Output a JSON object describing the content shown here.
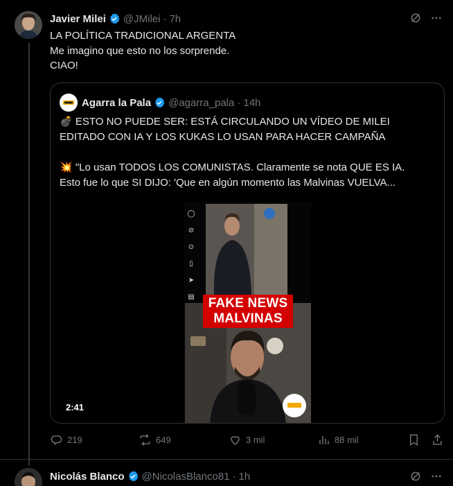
{
  "tweet": {
    "author_name": "Javier Milei",
    "author_handle": "@JMilei",
    "time": "7h",
    "lines": [
      "LA POLÍTICA TRADICIONAL ARGENTA",
      "Me imagino que esto no los sorprende.",
      "CIAO!"
    ],
    "icons": [
      "grok-icon",
      "more-icon"
    ]
  },
  "quote": {
    "author_name": "Agarra la Pala",
    "author_handle": "@agarra_pala",
    "time": "14h",
    "line1": "💣 ESTO NO PUEDE SER: ESTÁ CIRCULANDO UN VÍDEO DE MILEI",
    "line2": "EDITADO CON IA Y LOS KUKAS LO USAN PARA HACER CAMPAÑA",
    "line3": "💥 \"Lo usan TODOS LOS COMUNISTAS. Claramente se nota QUE ES IA.",
    "line4": "Esto fue lo que SI DIJO: 'Que en algún momento las Malvinas VUELVA...",
    "video_overlay_line1": "FAKE NEWS",
    "video_overlay_line2": "MALVINAS",
    "video_duration": "2:41",
    "overlay_color": "#d40000"
  },
  "actions": {
    "reply_count": "219",
    "repost_count": "649",
    "like_count": "3 mil",
    "views_count": "88 mil"
  },
  "next_tweet": {
    "author_name": "Nicolás Blanco",
    "author_handle": "@NicolasBlanco81",
    "time": "1h"
  },
  "colors": {
    "background": "#000000",
    "text": "#e7e9ea",
    "muted": "#71767b",
    "border": "#2f3336",
    "verified": "#1d9bf0"
  }
}
